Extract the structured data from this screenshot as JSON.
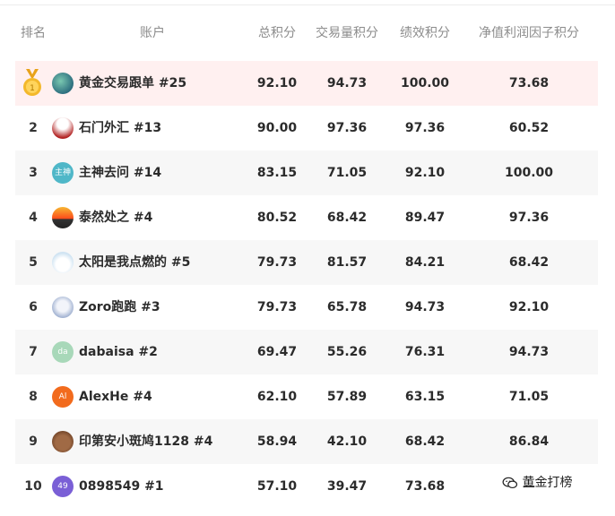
{
  "table": {
    "headers": {
      "rank": "排名",
      "account": "账户",
      "total": "总积分",
      "volume": "交易量积分",
      "performance": "绩效积分",
      "net_value": "净值利润因子积分"
    },
    "rows": [
      {
        "rank": "",
        "medal": "gold-medal-icon",
        "avatar_icon": "globe-avatar",
        "avatar_text": "",
        "avatar_color": "#3a7a8c",
        "account": "黄金交易跟单 #25",
        "total": "92.10",
        "volume": "94.73",
        "performance": "100.00",
        "net": "73.68"
      },
      {
        "rank": "2",
        "avatar_icon": "tower-avatar",
        "avatar_text": "",
        "avatar_color": "#b22222",
        "account": "石门外汇 #13",
        "total": "90.00",
        "volume": "97.36",
        "performance": "97.36",
        "net": "60.52"
      },
      {
        "rank": "3",
        "avatar_icon": "text-avatar",
        "avatar_text": "主神",
        "avatar_color": "#4fb7c8",
        "account": "主神去问 #14",
        "total": "83.15",
        "volume": "71.05",
        "performance": "92.10",
        "net": "100.00"
      },
      {
        "rank": "4",
        "avatar_icon": "sunset-avatar",
        "avatar_text": "",
        "avatar_color": "#e8870e",
        "account": "泰然处之 #4",
        "total": "80.52",
        "volume": "68.42",
        "performance": "89.47",
        "net": "97.36"
      },
      {
        "rank": "5",
        "avatar_icon": "cloud-avatar",
        "avatar_text": "",
        "avatar_color": "#cfe3f2",
        "account": "太阳是我点燃的 #5",
        "total": "79.73",
        "volume": "81.57",
        "performance": "84.21",
        "net": "68.42"
      },
      {
        "rank": "6",
        "avatar_icon": "anime-avatar",
        "avatar_text": "",
        "avatar_color": "#c9d6e8",
        "account": "Zoro跑跑 #3",
        "total": "79.73",
        "volume": "65.78",
        "performance": "94.73",
        "net": "92.10"
      },
      {
        "rank": "7",
        "avatar_icon": "text-avatar",
        "avatar_text": "da",
        "avatar_color": "#a8d8b9",
        "account": "dabaisa #2",
        "total": "69.47",
        "volume": "55.26",
        "performance": "76.31",
        "net": "94.73"
      },
      {
        "rank": "8",
        "avatar_icon": "text-avatar",
        "avatar_text": "Al",
        "avatar_color": "#f26b1d",
        "account": "AlexHe #4",
        "total": "62.10",
        "volume": "57.89",
        "performance": "63.15",
        "net": "71.05"
      },
      {
        "rank": "9",
        "avatar_icon": "dog-avatar",
        "avatar_text": "",
        "avatar_color": "#8b5a3c",
        "account": "印第安小斑鸠1128 #4",
        "total": "58.94",
        "volume": "42.10",
        "performance": "68.42",
        "net": "86.84"
      },
      {
        "rank": "10",
        "avatar_icon": "text-avatar",
        "avatar_text": "49",
        "avatar_color": "#7a5fd6",
        "account": "0898549 #1",
        "total": "57.10",
        "volume": "39.47",
        "performance": "73.68",
        "net": "—"
      }
    ]
  },
  "watermark": {
    "text": "黄金打榜",
    "icon": "wechat-icon"
  },
  "colors": {
    "top_row_bg": "#fff0f0",
    "alt_row_bg": "#f7f7f7",
    "header_text": "#8c8c8c"
  }
}
